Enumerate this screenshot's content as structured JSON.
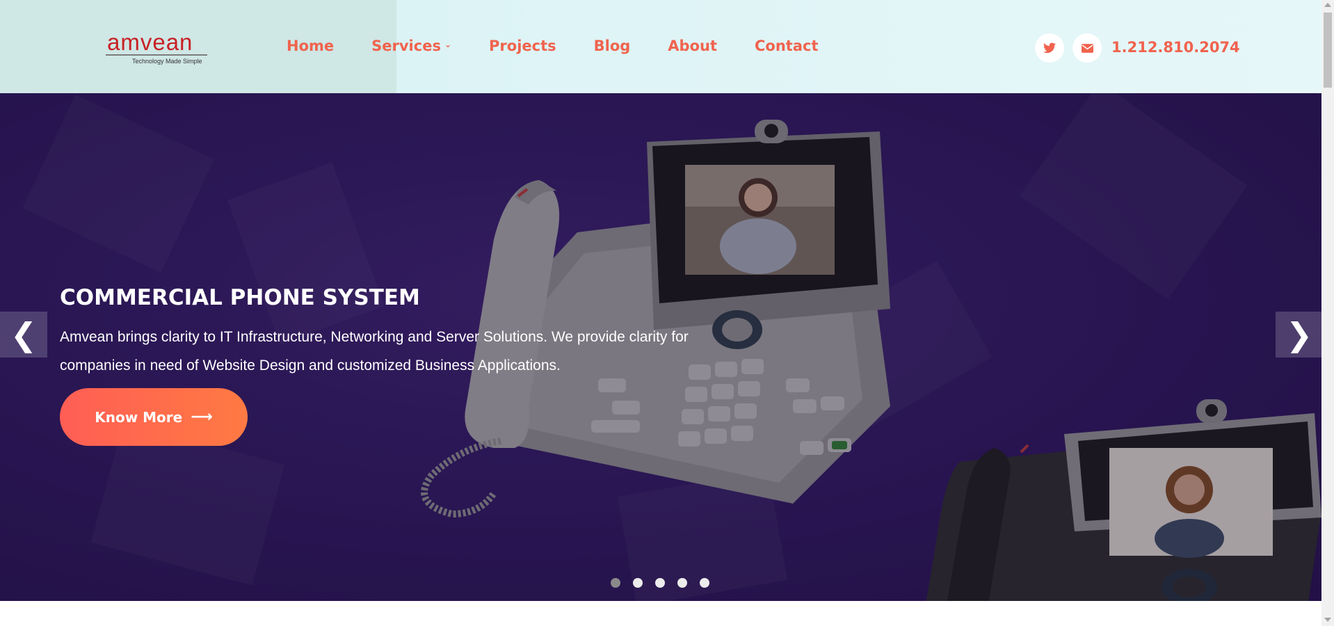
{
  "header": {
    "logo_text": "amvean",
    "logo_tagline": "Technology Made Simple",
    "nav": [
      {
        "label": "Home"
      },
      {
        "label": "Services"
      },
      {
        "label": "Projects"
      },
      {
        "label": "Blog"
      },
      {
        "label": "About"
      },
      {
        "label": "Contact"
      }
    ],
    "phone": "1.212.810.2074",
    "social_icons": [
      "twitter-icon",
      "mail-icon"
    ]
  },
  "hero": {
    "title": "COMMERCIAL PHONE SYSTEM",
    "text": "Amvean brings clarity to IT Infrastructure, Networking and Server Solutions. We provide clarity for companies in need of Website Design and customized Business Applications.",
    "button_label": "Know More",
    "slides": 5,
    "active_slide": 1
  },
  "colors": {
    "accent": "#f0634e",
    "hero_bg": "#321c62",
    "button_from": "#ff5e55",
    "button_to": "#ff7a43"
  }
}
